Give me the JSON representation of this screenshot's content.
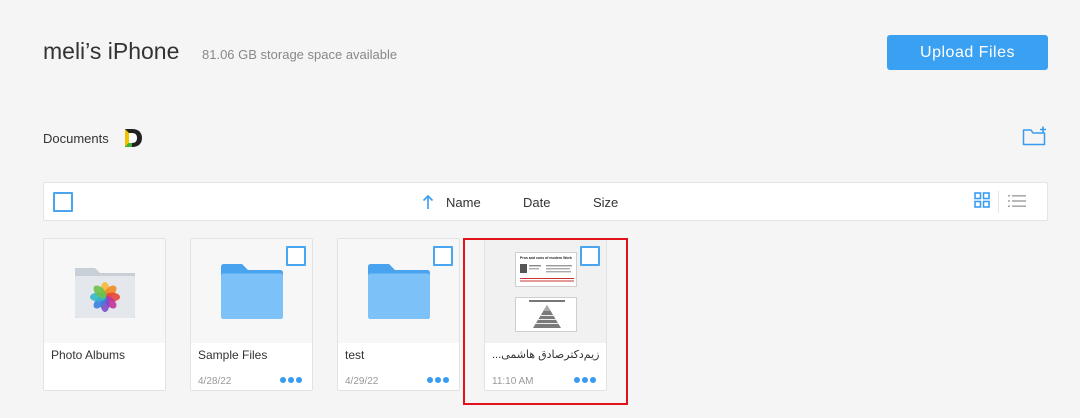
{
  "header": {
    "device_name": "meli’s iPhone",
    "storage_text": "81.06 GB storage space available",
    "upload_label": "Upload Files"
  },
  "location": {
    "label": "Documents",
    "app_icon": "documents-app-icon",
    "new_folder_icon": "new-folder-icon"
  },
  "toolbar": {
    "sort_icon": "arrow-up-icon",
    "columns": [
      "Name",
      "Date",
      "Size"
    ],
    "view_modes": [
      "grid-view-icon",
      "list-view-icon"
    ]
  },
  "files": [
    {
      "name": "Photo Albums",
      "type": "album",
      "date": ""
    },
    {
      "name": "Sample Files",
      "type": "folder",
      "date": "4/28/22"
    },
    {
      "name": "test",
      "type": "folder",
      "date": "4/29/22"
    },
    {
      "name": "...زیم‌دکترصادق هاشمی",
      "type": "document",
      "date": "11:10 AM",
      "thumbnail_text": "Pros and cons of modern Work"
    }
  ],
  "colors": {
    "accent": "#3aa0f2",
    "folder": "#6ab8f7",
    "highlight": "#e0121b",
    "background": "#f5f5f5"
  }
}
